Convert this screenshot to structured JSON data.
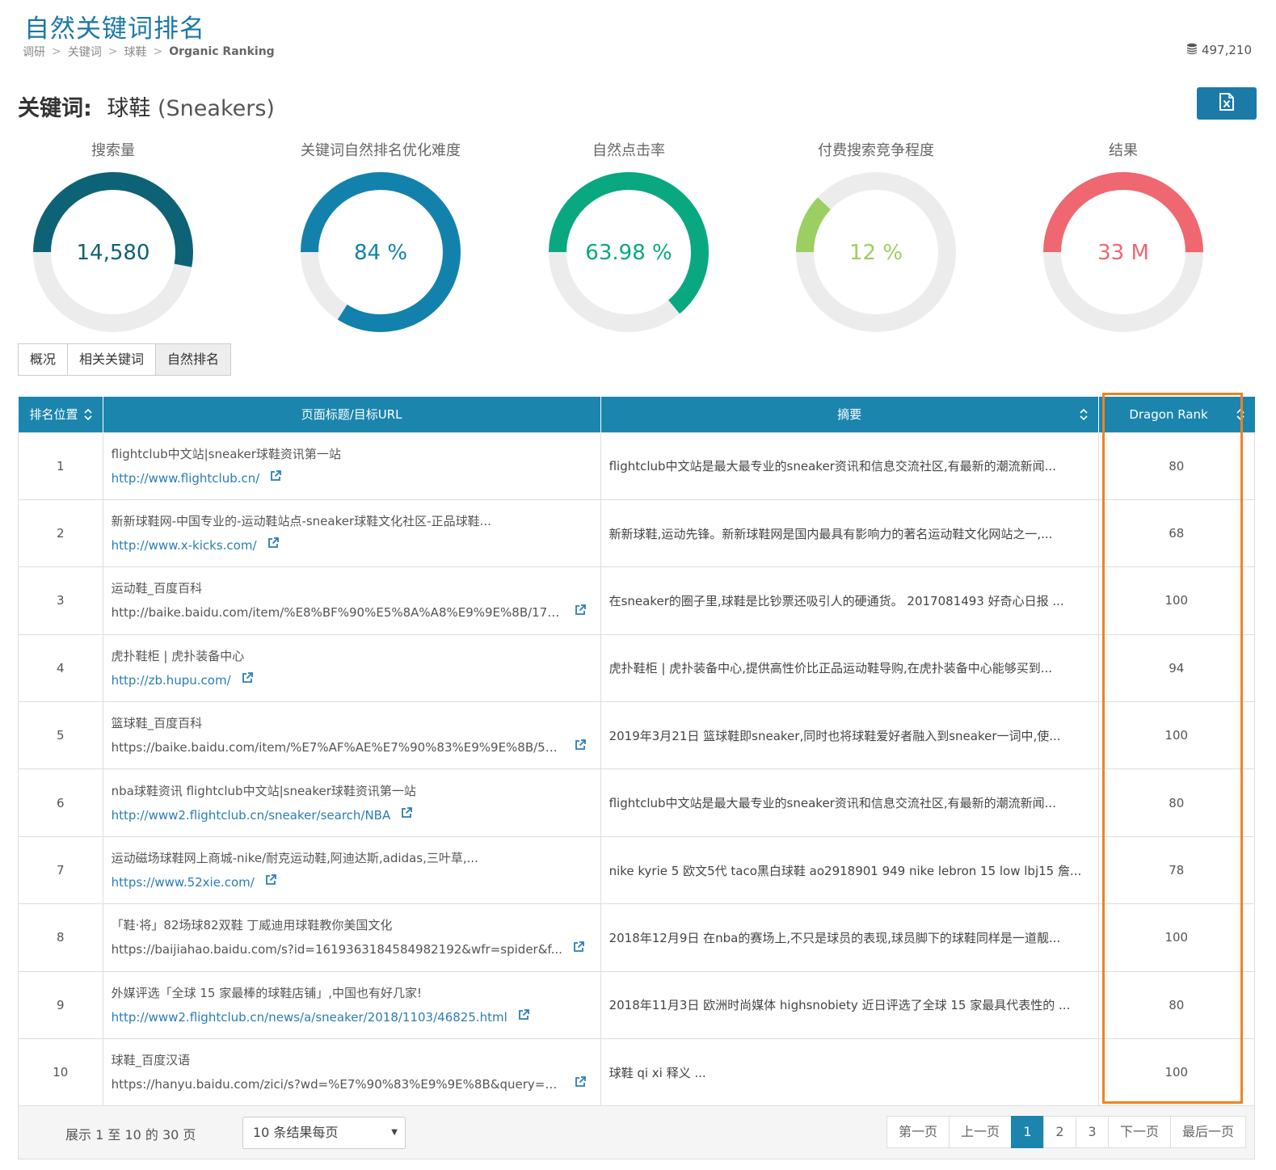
{
  "header": {
    "title": "自然关键词排名",
    "breadcrumb": [
      "调研",
      "关键词",
      "球鞋",
      "Organic Ranking"
    ],
    "credits": "497,210"
  },
  "keyword": {
    "label": "关键词:",
    "zh": "球鞋",
    "en": "(Sneakers)"
  },
  "metrics": [
    {
      "label": "搜索量",
      "value": "14,580",
      "fraction": 0.53,
      "color": "#0e6276"
    },
    {
      "label": "关键词自然排名优化难度",
      "value": "84 %",
      "fraction": 0.84,
      "color": "#1282ad"
    },
    {
      "label": "自然点击率",
      "value": "63.98 %",
      "fraction": 0.6398,
      "color": "#0aa880"
    },
    {
      "label": "付费搜索竞争程度",
      "value": "12 %",
      "fraction": 0.12,
      "color": "#9bcf62"
    },
    {
      "label": "结果",
      "value": "33 M",
      "fraction": 0.5,
      "color": "#ef6770"
    }
  ],
  "tabs": [
    "概况",
    "相关关键词",
    "自然排名"
  ],
  "table": {
    "headers": {
      "position": "排名位置",
      "title_url": "页面标题/目标URL",
      "summary": "摘要",
      "dragon_rank": "Dragon Rank"
    },
    "rows": [
      {
        "position": "1",
        "title": "flightclub中文站|sneaker球鞋资讯第一站",
        "url": "http://www.flightclub.cn/",
        "summary": "flightclub中文站是最大最专业的sneaker资讯和信息交流社区,有最新的潮流新闻...",
        "dr": "80"
      },
      {
        "position": "2",
        "title": "新新球鞋网-中国专业的-运动鞋站点-sneaker球鞋文化社区-正品球鞋...",
        "url": "http://www.x-kicks.com/",
        "summary": "新新球鞋,运动先锋。新新球鞋网是国内最具有影响力的著名运动鞋文化网站之一,...",
        "dr": "68"
      },
      {
        "position": "3",
        "title": "运动鞋_百度百科",
        "url": "http://baike.baidu.com/item/%E8%BF%90%E5%8A%A8%E9%9E%8B/175...",
        "summary": "在sneaker的圈子里,球鞋是比钞票还吸引人的硬通货。 2017081493 好奇心日报 ...",
        "dr": "100"
      },
      {
        "position": "4",
        "title": "虎扑鞋柜 | 虎扑装备中心",
        "url": "http://zb.hupu.com/",
        "summary": "虎扑鞋柜 | 虎扑装备中心,提供高性价比正品运动鞋导购,在虎扑装备中心能够买到...",
        "dr": "94"
      },
      {
        "position": "5",
        "title": "篮球鞋_百度百科",
        "url": "https://baike.baidu.com/item/%E7%AF%AE%E7%90%83%E9%9E%8B/57...",
        "summary": "2019年3月21日 篮球鞋即sneaker,同时也将球鞋爱好者融入到sneaker一词中,使...",
        "dr": "100"
      },
      {
        "position": "6",
        "title": "nba球鞋资讯 flightclub中文站|sneaker球鞋资讯第一站",
        "url": "http://www2.flightclub.cn/sneaker/search/NBA",
        "summary": "flightclub中文站是最大最专业的sneaker资讯和信息交流社区,有最新的潮流新闻...",
        "dr": "80"
      },
      {
        "position": "7",
        "title": "运动磁场球鞋网上商城-nike/耐克运动鞋,阿迪达斯,adidas,三叶草,...",
        "url": "https://www.52xie.com/",
        "summary": "nike kyrie 5 欧文5代 taco黑白球鞋 ao2918901 949 nike lebron 15 low lbj15 詹...",
        "dr": "78"
      },
      {
        "position": "8",
        "title": "「鞋·将」82场球82双鞋 丁威迪用球鞋教你美国文化",
        "url": "https://baijiahao.baidu.com/s?id=1619363184584982192&wfr=spider&f...",
        "summary": "2018年12月9日 在nba的赛场上,不只是球员的表现,球员脚下的球鞋同样是一道靓...",
        "dr": "100"
      },
      {
        "position": "9",
        "title": "外媒评选「全球 15 家最棒的球鞋店铺」,中国也有好几家!",
        "url": "http://www2.flightclub.cn/news/a/sneaker/2018/1103/46825.html",
        "summary": "2018年11月3日 欧洲时尚媒体 highsnobiety 近日评选了全球 15 家最具代表性的 ...",
        "dr": "80"
      },
      {
        "position": "10",
        "title": "球鞋_百度汉语",
        "url": "https://hanyu.baidu.com/zici/s?wd=%E7%90%83%E9%9E%8B&query=%...",
        "summary": "球鞋 qi xi 释义 ...",
        "dr": "100"
      }
    ]
  },
  "footer": {
    "info": "展示 1 至 10 的 30 页",
    "page_size": "10 条结果每页",
    "pagination": {
      "first": "第一页",
      "prev": "上一页",
      "pages": [
        "1",
        "2",
        "3"
      ],
      "current": "1",
      "next": "下一页",
      "last": "最后一页"
    }
  }
}
